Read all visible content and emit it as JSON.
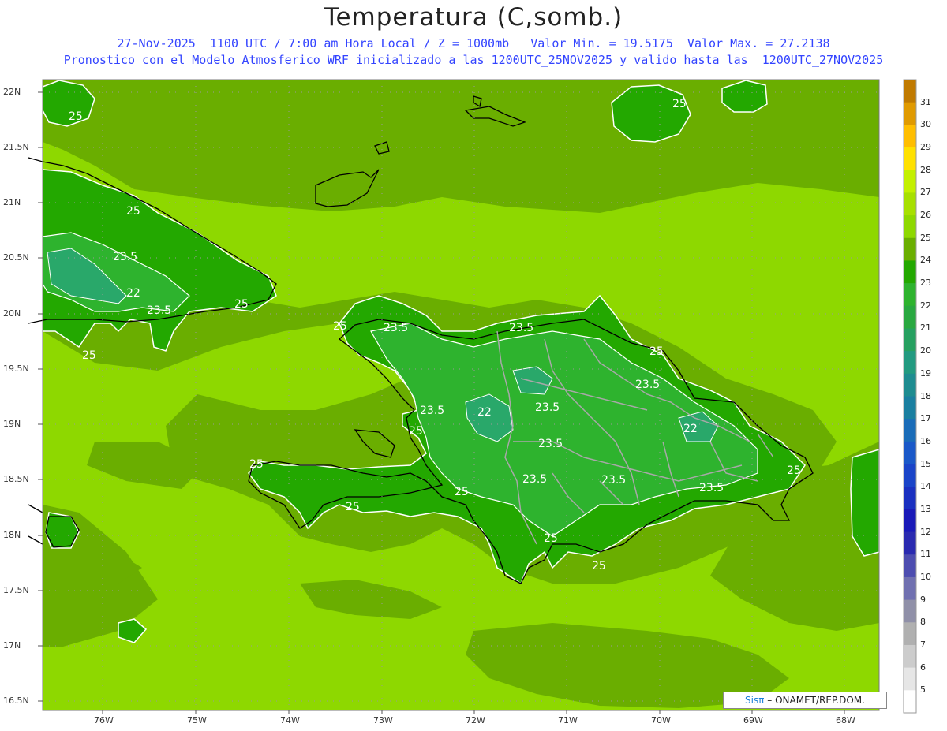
{
  "header": {
    "title": "Temperatura (C,somb.)",
    "line1": "27-Nov-2025  1100 UTC / 7:00 am Hora Local / Z = 1000mb   Valor Min. = 19.5175  Valor Max. = 27.2138",
    "line2": "Pronostico con el Modelo Atmosferico WRF inicializado a las 1200UTC_25NOV2025 y valido hasta las  1200UTC_27NOV2025"
  },
  "axes": {
    "lat_labels": [
      "22N",
      "21.5N",
      "21N",
      "20.5N",
      "20N",
      "19.5N",
      "19N",
      "18.5N",
      "18N",
      "17.5N",
      "17N",
      "16.5N"
    ],
    "lon_labels": [
      "76W",
      "75W",
      "74W",
      "73W",
      "72W",
      "71W",
      "70W",
      "69W",
      "68W"
    ]
  },
  "colorbar": {
    "labels": [
      "31",
      "30",
      "29",
      "28",
      "27",
      "26",
      "25",
      "24",
      "23",
      "22",
      "21",
      "20",
      "19",
      "18",
      "17",
      "16",
      "15",
      "14",
      "13",
      "12",
      "11",
      "10",
      "9",
      "8",
      "7",
      "6",
      "5"
    ],
    "colors": [
      "#c07a00",
      "#e09a00",
      "#ffbe00",
      "#ffe100",
      "#c3f000",
      "#a7e000",
      "#8ed800",
      "#6aae00",
      "#23a800",
      "#2eb32e",
      "#29a840",
      "#26a060",
      "#229a80",
      "#1e8c90",
      "#1a7fa0",
      "#1a6cb8",
      "#1a58c8",
      "#1a44c8",
      "#1a30c0",
      "#1a1ab8",
      "#2a2ab0",
      "#4d4db0",
      "#7070b0",
      "#9090a8",
      "#b0b0b0",
      "#cccccc",
      "#e6e6e6",
      "#ffffff"
    ]
  },
  "contour_labels": [
    "25",
    "25",
    "25",
    "23.5",
    "22",
    "23.5",
    "25",
    "25",
    "25",
    "23.5",
    "23.5",
    "25",
    "23.5",
    "22",
    "23.5",
    "23.5",
    "25",
    "22",
    "23.5",
    "23.5",
    "23.5",
    "23.5",
    "25",
    "25",
    "25",
    "25",
    "25"
  ],
  "credit": {
    "sis": "Sisπ",
    "rest": "– ONAMET/REP.DOM."
  }
}
